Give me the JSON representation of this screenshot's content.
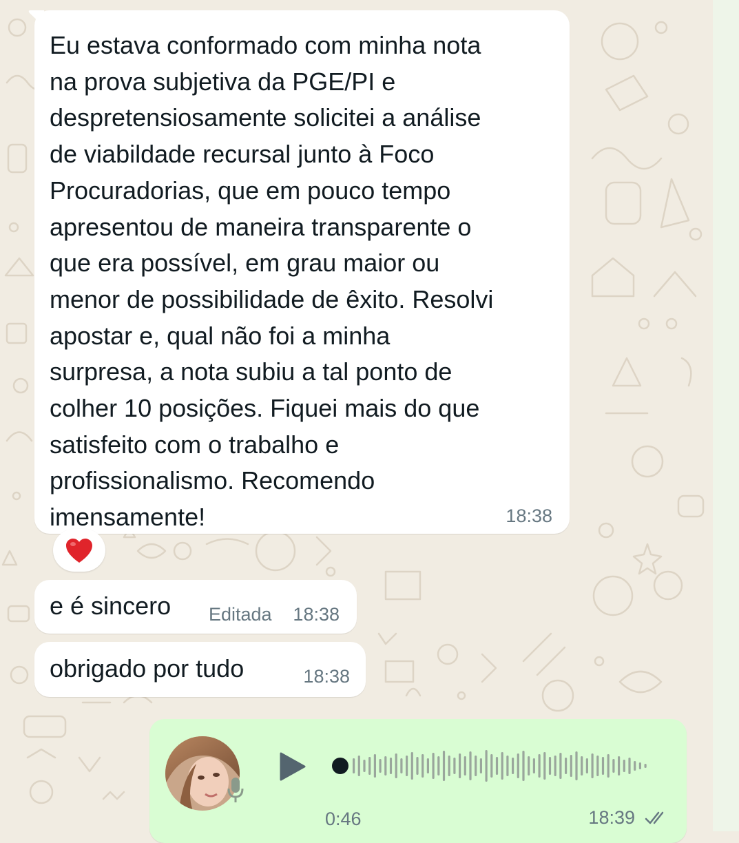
{
  "messages": [
    {
      "text": "Eu estava conformado com minha nota\nna prova subjetiva da PGE/PI e\ndespretensiosamente solicitei a análise\nde viabildade recursal junto à Foco\nProcuradorias, que em pouco tempo\napresentou de maneira transparente o\nque era possível, em grau maior ou\nmenor de possibilidade de êxito. Resolvi\napostar e, qual não foi a minha\nsurpresa, a nota subiu a tal ponto de\ncolher 10 posições. Fiquei mais do que\nsatisfeito com o trabalho e\nprofissionalismo. Recomendo\nimensamente!",
      "time": "18:38",
      "reaction": "❤️"
    },
    {
      "text": "e é sincero",
      "edited_label": "Editada",
      "time": "18:38"
    },
    {
      "text": "obrigado por tudo",
      "time": "18:38"
    }
  ],
  "voice_message": {
    "duration": "0:46",
    "time": "18:39",
    "status": "read",
    "play_icon": "play-icon",
    "mic_icon": "microphone-icon"
  },
  "colors": {
    "wallpaper": "#f1ece2",
    "incoming_bubble": "#ffffff",
    "outgoing_bubble": "#d9fdd3",
    "text": "#111b21",
    "meta_text": "#667781",
    "reaction_heart": "#e0242b"
  }
}
